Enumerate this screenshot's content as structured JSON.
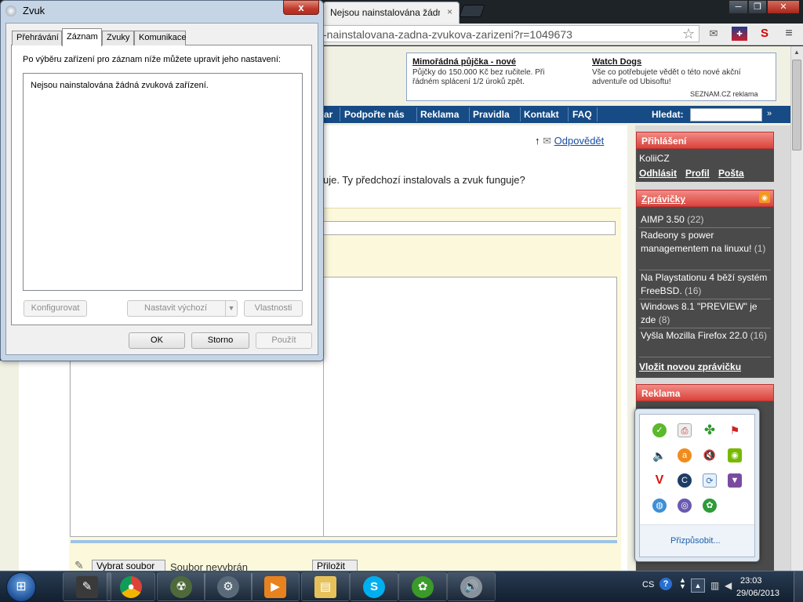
{
  "browser": {
    "tab_title": "Nejsou nainstalována žádn",
    "tab_close": "×",
    "url": "-nainstalovana-zadna-zvukova-zarizeni?r=1049673",
    "icons": [
      "star-icon",
      "mail-extension-icon",
      "flag-extension-icon",
      "sklik-extension-icon",
      "menu-icon"
    ]
  },
  "page": {
    "ads": [
      {
        "title": "Mimořádná půjčka - nové",
        "text": "Půjčky do 150.000 Kč bez ručitele. Při řádném splácení 1/2 úroků zpět."
      },
      {
        "title": "Watch Dogs",
        "text": "Vše co potřebujete vědět o této nové akční adventuře od Ubisoftu!"
      }
    ],
    "ad_footer": "SEZNAM.CZ reklama",
    "nav": [
      "ar",
      "Podpořte nás",
      "Reklama",
      "Pravidla",
      "Kontakt",
      "FAQ"
    ],
    "search_label": "Hledat:",
    "search_go": "»",
    "reply_link": "Odpovědět",
    "post_text": "uje. Ty předchozí instalovals a zvuk funguje?",
    "choose_file": "Vybrat soubor",
    "no_file": "Soubor nevybrán",
    "attach": "Přiložit"
  },
  "sidebar": {
    "login_title": "Přihlášení",
    "user": "KoliiCZ",
    "logout": "Odhlásit",
    "profile": "Profil",
    "mail": "Pošta",
    "news_title": "Zprávičky",
    "news": [
      {
        "text": "AIMP 3.50",
        "count": "(22)"
      },
      {
        "text": "Radeony s power managementem na linuxu!",
        "count": "(1)"
      },
      {
        "text": "Na Playstationu 4 běží systém FreeBSD.",
        "count": "(16)"
      },
      {
        "text": "Windows 8.1 \"PREVIEW\" je zde",
        "count": "(8)"
      },
      {
        "text": "Vyšla Mozilla Firefox 22.0",
        "count": "(16)"
      }
    ],
    "news_add": "Vložit novou zprávičku",
    "ad_title": "Reklama"
  },
  "dialog": {
    "title": "Zvuk",
    "close": "x",
    "tabs": [
      "Přehrávání",
      "Záznam",
      "Zvuky",
      "Komunikace"
    ],
    "active_tab": "Záznam",
    "instruction": "Po výběru zařízení pro záznam níže můžete upravit jeho nastavení:",
    "empty_list": "Nejsou nainstalována žádná zvuková zařízení.",
    "buttons": {
      "configure": "Konfigurovat",
      "set_default": "Nastavit výchozí",
      "properties": "Vlastnosti",
      "ok": "OK",
      "cancel": "Storno",
      "apply": "Použít"
    }
  },
  "tray_popup": {
    "icons": [
      "evernote-icon",
      "printer-error-icon",
      "daemon-tools-icon",
      "flag-warning-icon",
      "speaker-icon",
      "avast-icon",
      "speaker-muted-icon",
      "nvidia-icon",
      "antivirus-shield-icon",
      "ccleaner-icon",
      "update-icon",
      "security-shield-icon",
      "network-globe-icon",
      "network-connection-icon",
      "icq-status-icon"
    ],
    "customize": "Přizpůsobit..."
  },
  "taskbar": {
    "apps": [
      "notepad-app",
      "chrome-app",
      "stalker-app",
      "steam-app",
      "media-player-app",
      "explorer-app",
      "skype-app",
      "icq-app",
      "volume-app"
    ],
    "language": "CS",
    "help": "?",
    "time": "23:03",
    "date": "29/06/2013"
  }
}
